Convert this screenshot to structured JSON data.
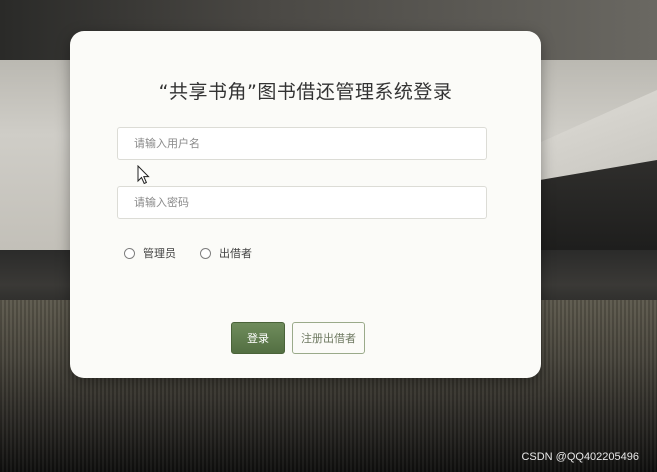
{
  "login": {
    "title": "“共享书角”图书借还管理系统登录",
    "username_placeholder": "请输入用户名",
    "password_placeholder": "请输入密码",
    "roles": [
      {
        "label": "管理员"
      },
      {
        "label": "出借者"
      }
    ],
    "login_button": "登录",
    "register_button": "注册出借者"
  },
  "watermark": "CSDN @QQ402205496",
  "colors": {
    "primary_button": "#5f7c4d",
    "secondary_button_border": "#9aaa8a",
    "card_background": "#fbfbf8"
  }
}
